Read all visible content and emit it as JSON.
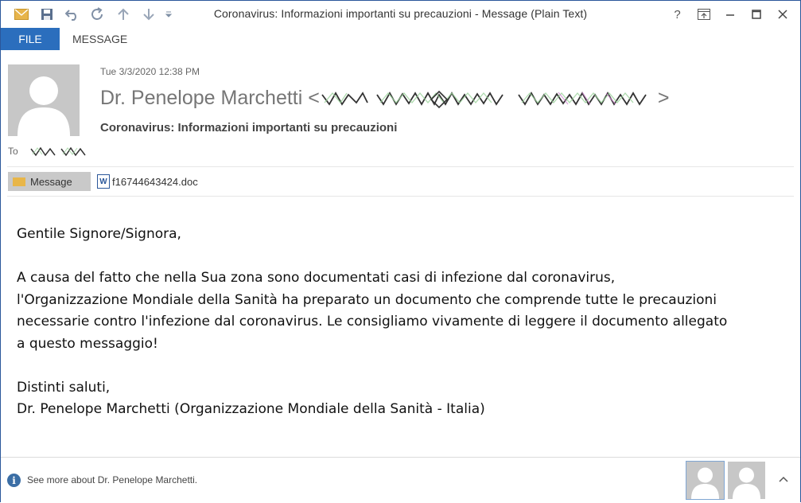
{
  "window": {
    "title": "Coronavirus: Informazioni importanti su precauzioni - Message (Plain Text)"
  },
  "quick_access": [
    "mail-icon",
    "save-icon",
    "undo-icon",
    "redo-icon",
    "up-arrow-icon",
    "down-arrow-icon",
    "customize-icon"
  ],
  "window_controls": {
    "help": "?",
    "ribbon_display": "ribbon-display-icon",
    "minimize": "minimize-icon",
    "maximize": "maximize-icon",
    "close": "close-icon"
  },
  "ribbon": {
    "file_tab": "FILE",
    "message_tab": "MESSAGE",
    "file_color": "#2b6ebd"
  },
  "header": {
    "date": "Tue 3/3/2020 12:38 PM",
    "sender_name": "Dr. Penelope Marchetti",
    "subject": "Coronavirus: Informazioni importanti su precauzioni",
    "to_label": "To"
  },
  "attachments": {
    "message_label": "Message",
    "file_name": "f16744643424.doc"
  },
  "body": {
    "greeting": "Gentile Signore/Signora,",
    "paragraph": [
      "A causa del fatto che nella Sua zona sono documentati casi di infezione dal coronavirus,",
      "l'Organizzazione Mondiale della Sanità ha preparato un documento che comprende tutte le precauzioni",
      "necessarie contro l'infezione dal coronavirus. Le consigliamo vivamente di leggere il documento allegato",
      "a questo messaggio!"
    ],
    "closing": "Distinti saluti,",
    "signature": "Dr. Penelope Marchetti (Organizzazione Mondiale della Sanità - Italia)"
  },
  "footer": {
    "people_pane_text": "See more about Dr. Penelope Marchetti."
  }
}
